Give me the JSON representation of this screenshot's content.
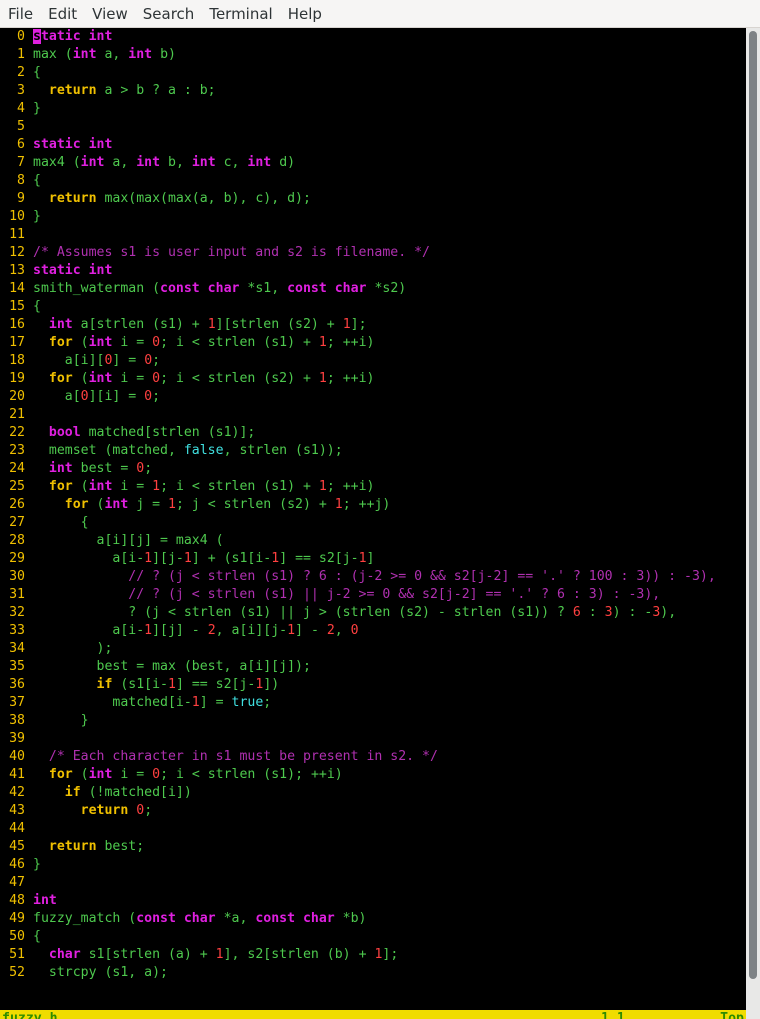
{
  "menubar": {
    "items": [
      "File",
      "Edit",
      "View",
      "Search",
      "Terminal",
      "Help"
    ]
  },
  "editor": {
    "lines": [
      [
        [
          "kw",
          "static int"
        ]
      ],
      [
        [
          "p",
          "max ("
        ],
        [
          "kw",
          "int"
        ],
        [
          "p",
          " a, "
        ],
        [
          "kw",
          "int"
        ],
        [
          "p",
          " b)"
        ]
      ],
      [
        [
          "p",
          "{"
        ]
      ],
      [
        [
          "p",
          "  "
        ],
        [
          "ctl",
          "return"
        ],
        [
          "p",
          " a > b ? a : b;"
        ]
      ],
      [
        [
          "p",
          "}"
        ]
      ],
      [],
      [
        [
          "kw",
          "static int"
        ]
      ],
      [
        [
          "p",
          "max4 ("
        ],
        [
          "kw",
          "int"
        ],
        [
          "p",
          " a, "
        ],
        [
          "kw",
          "int"
        ],
        [
          "p",
          " b, "
        ],
        [
          "kw",
          "int"
        ],
        [
          "p",
          " c, "
        ],
        [
          "kw",
          "int"
        ],
        [
          "p",
          " d)"
        ]
      ],
      [
        [
          "p",
          "{"
        ]
      ],
      [
        [
          "p",
          "  "
        ],
        [
          "ctl",
          "return"
        ],
        [
          "p",
          " max(max(max(a, b), c), d);"
        ]
      ],
      [
        [
          "p",
          "}"
        ]
      ],
      [],
      [
        [
          "cmt",
          "/* Assumes s1 is user input and s2 is filename. */"
        ]
      ],
      [
        [
          "kw",
          "static int"
        ]
      ],
      [
        [
          "p",
          "smith_waterman ("
        ],
        [
          "kw",
          "const char"
        ],
        [
          "p",
          " *s1, "
        ],
        [
          "kw",
          "const char"
        ],
        [
          "p",
          " *s2)"
        ]
      ],
      [
        [
          "p",
          "{"
        ]
      ],
      [
        [
          "p",
          "  "
        ],
        [
          "kw",
          "int"
        ],
        [
          "p",
          " a[strlen (s1) + "
        ],
        [
          "num",
          "1"
        ],
        [
          "p",
          "][strlen (s2) + "
        ],
        [
          "num",
          "1"
        ],
        [
          "p",
          "];"
        ]
      ],
      [
        [
          "p",
          "  "
        ],
        [
          "ctl",
          "for"
        ],
        [
          "p",
          " ("
        ],
        [
          "kw",
          "int"
        ],
        [
          "p",
          " i = "
        ],
        [
          "num",
          "0"
        ],
        [
          "p",
          "; i < strlen (s1) + "
        ],
        [
          "num",
          "1"
        ],
        [
          "p",
          "; ++i)"
        ]
      ],
      [
        [
          "p",
          "    a[i]["
        ],
        [
          "num",
          "0"
        ],
        [
          "p",
          "] = "
        ],
        [
          "num",
          "0"
        ],
        [
          "p",
          ";"
        ]
      ],
      [
        [
          "p",
          "  "
        ],
        [
          "ctl",
          "for"
        ],
        [
          "p",
          " ("
        ],
        [
          "kw",
          "int"
        ],
        [
          "p",
          " i = "
        ],
        [
          "num",
          "0"
        ],
        [
          "p",
          "; i < strlen (s2) + "
        ],
        [
          "num",
          "1"
        ],
        [
          "p",
          "; ++i)"
        ]
      ],
      [
        [
          "p",
          "    a["
        ],
        [
          "num",
          "0"
        ],
        [
          "p",
          "][i] = "
        ],
        [
          "num",
          "0"
        ],
        [
          "p",
          ";"
        ]
      ],
      [],
      [
        [
          "p",
          "  "
        ],
        [
          "kw",
          "bool"
        ],
        [
          "p",
          " matched[strlen (s1)];"
        ]
      ],
      [
        [
          "p",
          "  memset (matched, "
        ],
        [
          "const",
          "false"
        ],
        [
          "p",
          ", strlen (s1));"
        ]
      ],
      [
        [
          "p",
          "  "
        ],
        [
          "kw",
          "int"
        ],
        [
          "p",
          " best = "
        ],
        [
          "num",
          "0"
        ],
        [
          "p",
          ";"
        ]
      ],
      [
        [
          "p",
          "  "
        ],
        [
          "ctl",
          "for"
        ],
        [
          "p",
          " ("
        ],
        [
          "kw",
          "int"
        ],
        [
          "p",
          " i = "
        ],
        [
          "num",
          "1"
        ],
        [
          "p",
          "; i < strlen (s1) + "
        ],
        [
          "num",
          "1"
        ],
        [
          "p",
          "; ++i)"
        ]
      ],
      [
        [
          "p",
          "    "
        ],
        [
          "ctl",
          "for"
        ],
        [
          "p",
          " ("
        ],
        [
          "kw",
          "int"
        ],
        [
          "p",
          " j = "
        ],
        [
          "num",
          "1"
        ],
        [
          "p",
          "; j < strlen (s2) + "
        ],
        [
          "num",
          "1"
        ],
        [
          "p",
          "; ++j)"
        ]
      ],
      [
        [
          "p",
          "      {"
        ]
      ],
      [
        [
          "p",
          "        a[i][j] = max4 ("
        ]
      ],
      [
        [
          "p",
          "          a[i-"
        ],
        [
          "num",
          "1"
        ],
        [
          "p",
          "][j-"
        ],
        [
          "num",
          "1"
        ],
        [
          "p",
          "] + (s1[i-"
        ],
        [
          "num",
          "1"
        ],
        [
          "p",
          "] == s2[j-"
        ],
        [
          "num",
          "1"
        ],
        [
          "p",
          "]"
        ]
      ],
      [
        [
          "p",
          "            "
        ],
        [
          "cmt",
          "// ? (j < strlen (s1) ? 6 : (j-2 >= 0 && s2[j-2] == '.' ? 100 : 3)) : -3),"
        ]
      ],
      [
        [
          "p",
          "            "
        ],
        [
          "cmt",
          "// ? (j < strlen (s1) || j-2 >= 0 && s2[j-2] == '.' ? 6 : 3) : -3),"
        ]
      ],
      [
        [
          "p",
          "            ? (j < strlen (s1) || j > (strlen (s2) - strlen (s1)) ? "
        ],
        [
          "num",
          "6"
        ],
        [
          "p",
          " : "
        ],
        [
          "num",
          "3"
        ],
        [
          "p",
          ") : -"
        ],
        [
          "num",
          "3"
        ],
        [
          "p",
          "),"
        ]
      ],
      [
        [
          "p",
          "          a[i-"
        ],
        [
          "num",
          "1"
        ],
        [
          "p",
          "][j] - "
        ],
        [
          "num",
          "2"
        ],
        [
          "p",
          ", a[i][j-"
        ],
        [
          "num",
          "1"
        ],
        [
          "p",
          "] - "
        ],
        [
          "num",
          "2"
        ],
        [
          "p",
          ", "
        ],
        [
          "num",
          "0"
        ]
      ],
      [
        [
          "p",
          "        );"
        ]
      ],
      [
        [
          "p",
          "        best = max (best, a[i][j]);"
        ]
      ],
      [
        [
          "p",
          "        "
        ],
        [
          "ctl",
          "if"
        ],
        [
          "p",
          " (s1[i-"
        ],
        [
          "num",
          "1"
        ],
        [
          "p",
          "] == s2[j-"
        ],
        [
          "num",
          "1"
        ],
        [
          "p",
          "])"
        ]
      ],
      [
        [
          "p",
          "          matched[i-"
        ],
        [
          "num",
          "1"
        ],
        [
          "p",
          "] = "
        ],
        [
          "const",
          "true"
        ],
        [
          "p",
          ";"
        ]
      ],
      [
        [
          "p",
          "      }"
        ]
      ],
      [],
      [
        [
          "p",
          "  "
        ],
        [
          "cmt",
          "/* Each character in s1 must be present in s2. */"
        ]
      ],
      [
        [
          "p",
          "  "
        ],
        [
          "ctl",
          "for"
        ],
        [
          "p",
          " ("
        ],
        [
          "kw",
          "int"
        ],
        [
          "p",
          " i = "
        ],
        [
          "num",
          "0"
        ],
        [
          "p",
          "; i < strlen (s1); ++i)"
        ]
      ],
      [
        [
          "p",
          "    "
        ],
        [
          "ctl",
          "if"
        ],
        [
          "p",
          " (!matched[i])"
        ]
      ],
      [
        [
          "p",
          "      "
        ],
        [
          "ctl",
          "return"
        ],
        [
          "p",
          " "
        ],
        [
          "num",
          "0"
        ],
        [
          "p",
          ";"
        ]
      ],
      [],
      [
        [
          "p",
          "  "
        ],
        [
          "ctl",
          "return"
        ],
        [
          "p",
          " best;"
        ]
      ],
      [
        [
          "p",
          "}"
        ]
      ],
      [],
      [
        [
          "kw",
          "int"
        ]
      ],
      [
        [
          "p",
          "fuzzy_match ("
        ],
        [
          "kw",
          "const char"
        ],
        [
          "p",
          " *a, "
        ],
        [
          "kw",
          "const char"
        ],
        [
          "p",
          " *b)"
        ]
      ],
      [
        [
          "p",
          "{"
        ]
      ],
      [
        [
          "p",
          "  "
        ],
        [
          "kw",
          "char"
        ],
        [
          "p",
          " s1[strlen (a) + "
        ],
        [
          "num",
          "1"
        ],
        [
          "p",
          "], s2[strlen (b) + "
        ],
        [
          "num",
          "1"
        ],
        [
          "p",
          "];"
        ]
      ],
      [
        [
          "p",
          "  strcpy (s1, a);"
        ]
      ]
    ]
  },
  "status": {
    "file": "fuzzy.h",
    "position": "1,1",
    "scroll": "Top"
  },
  "colors": {
    "background": "#000000",
    "text": "#4ec94e",
    "line_number": "#f0c000",
    "type_keyword": "#e020e0",
    "control_keyword": "#f0c000",
    "comment": "#b030b0",
    "number": "#ff4040",
    "constant": "#40e0e0",
    "statusbar_bg": "#f0dc00"
  }
}
